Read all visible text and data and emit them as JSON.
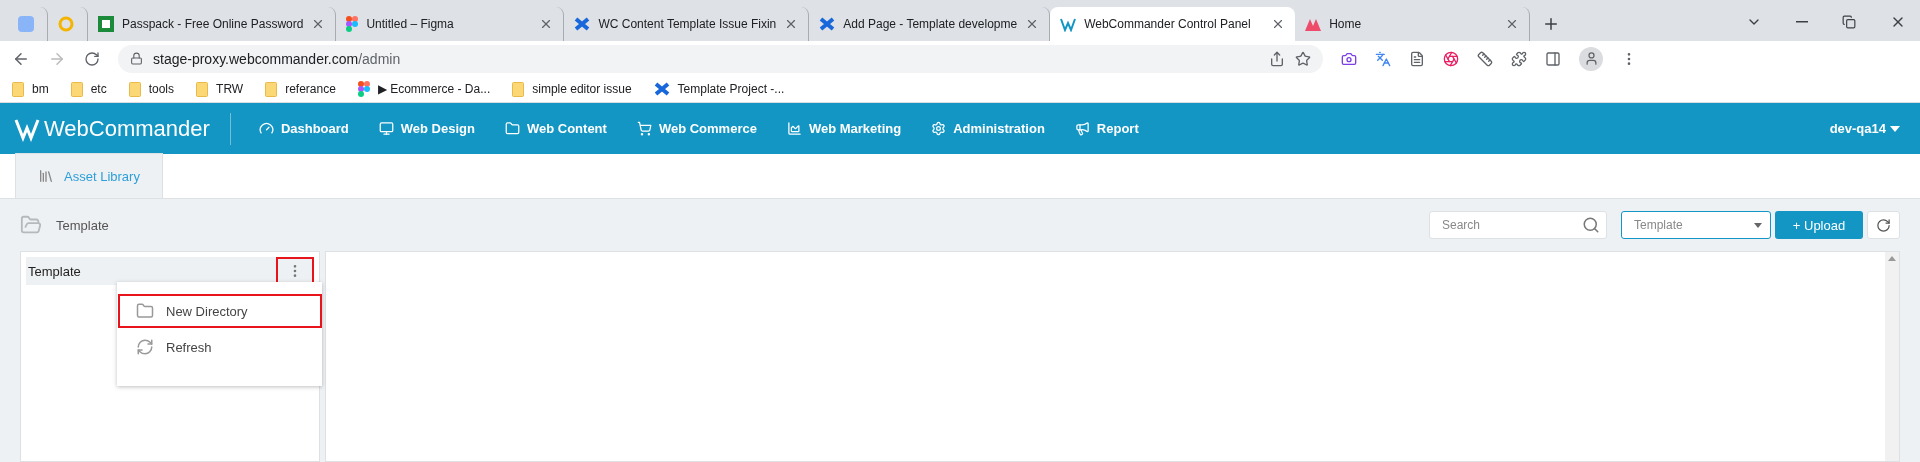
{
  "browser": {
    "tabs": [
      {
        "kind": "pinned-blue",
        "selected": false
      },
      {
        "kind": "pinned-ring",
        "selected": false
      },
      {
        "kind": "passpack",
        "title": "Passpack - Free Online Password",
        "selected": false
      },
      {
        "kind": "figma",
        "title": "Untitled – Figma",
        "selected": false
      },
      {
        "kind": "confluence",
        "title": "WC Content Template Issue Fixin",
        "selected": false
      },
      {
        "kind": "confluence",
        "title": "Add Page - Template developme",
        "selected": false
      },
      {
        "kind": "webcommander",
        "title": "WebCommander Control Panel",
        "selected": true
      },
      {
        "kind": "home",
        "title": "Home",
        "selected": false
      }
    ],
    "address": {
      "host": "stage-proxy.webcommander.com",
      "path": "/admin"
    },
    "bookmarks": [
      {
        "kind": "folder",
        "label": "bm"
      },
      {
        "kind": "folder",
        "label": "etc"
      },
      {
        "kind": "folder",
        "label": "tools"
      },
      {
        "kind": "folder",
        "label": "TRW"
      },
      {
        "kind": "folder",
        "label": "referance"
      },
      {
        "kind": "figma",
        "label": "▶ Ecommerce - Da..."
      },
      {
        "kind": "folder",
        "label": "simple editor issue"
      },
      {
        "kind": "confluence",
        "label": "Template Project -..."
      }
    ]
  },
  "app": {
    "brand": "WebCommander",
    "nav": [
      {
        "kind": "dashboard",
        "label": "Dashboard"
      },
      {
        "kind": "design",
        "label": "Web Design"
      },
      {
        "kind": "content",
        "label": "Web Content"
      },
      {
        "kind": "commerce",
        "label": "Web Commerce"
      },
      {
        "kind": "marketing",
        "label": "Web Marketing"
      },
      {
        "kind": "admin",
        "label": "Administration"
      },
      {
        "kind": "report",
        "label": "Report"
      }
    ],
    "user": "dev-qa14",
    "page_tabs": [
      {
        "label": "Asset Library",
        "selected": true
      }
    ],
    "breadcrumb": "Template",
    "search": {
      "placeholder": "Search"
    },
    "type_select": {
      "value": "Template"
    },
    "upload_button": "+ Upload",
    "tree": {
      "root": "Template",
      "menu_button_highlighted": true,
      "menu": [
        {
          "kind": "new-directory",
          "label": "New Directory",
          "highlighted": true
        },
        {
          "kind": "refresh",
          "label": "Refresh",
          "highlighted": false
        }
      ]
    }
  }
}
